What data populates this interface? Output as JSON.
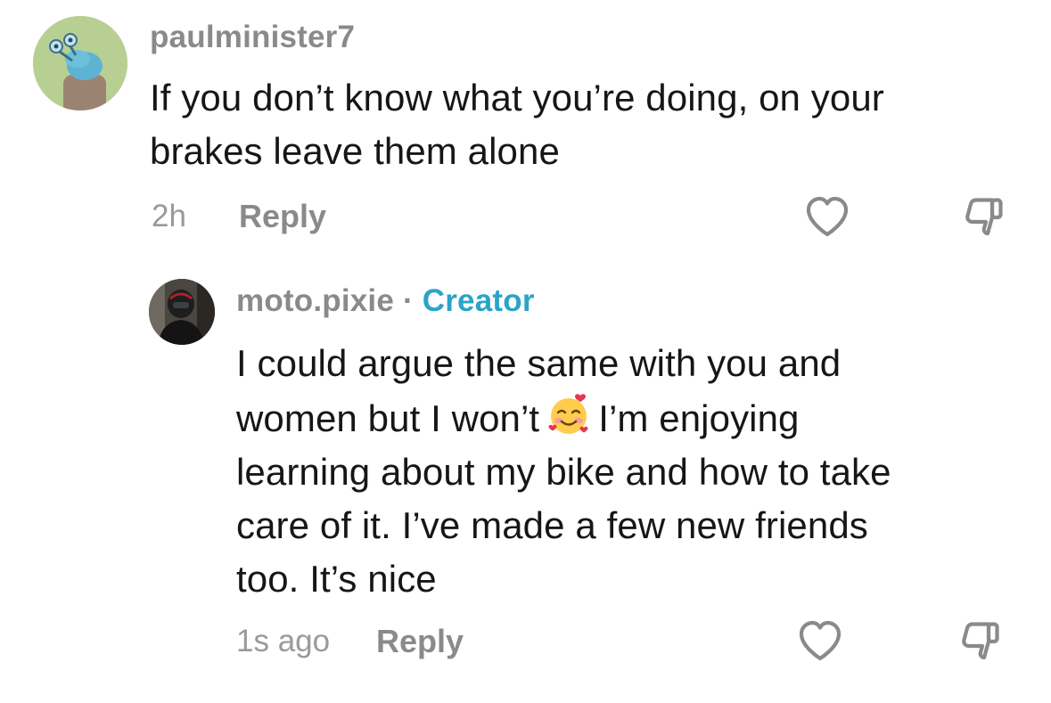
{
  "comments": [
    {
      "username": "paulminister7",
      "text_lines": [
        "If you don’t know what you’re doing, on your",
        "brakes leave them alone"
      ],
      "time": "2h",
      "reply_label": "Reply",
      "like_icon": "heart-outline-icon",
      "dislike_icon": "thumbs-down-icon"
    },
    {
      "username": "moto.pixie",
      "separator": "·",
      "badge": "Creator",
      "text_lines": [
        "I could argue the same with you and",
        "women but I won’t",
        "I’m enjoying",
        "learning about my bike and how to take",
        "care of it. I’ve made a few new friends",
        "too. It’s nice"
      ],
      "emoji": "smiling-face-with-hearts-emoji",
      "time": "1s ago",
      "reply_label": "Reply",
      "like_icon": "heart-outline-icon",
      "dislike_icon": "thumbs-down-icon"
    }
  ],
  "colors": {
    "text": "#161616",
    "meta": "#8a8a8a",
    "creator_badge": "#2aa4c9",
    "icon_stroke": "#8a8a8a"
  }
}
